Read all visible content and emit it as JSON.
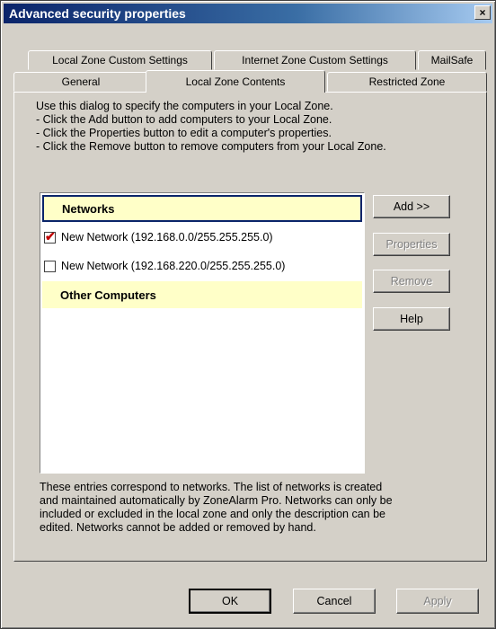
{
  "window": {
    "title": "Advanced security properties",
    "close_glyph": "×"
  },
  "tabs_row1": [
    {
      "label": "Local Zone Custom Settings"
    },
    {
      "label": "Internet Zone Custom Settings"
    },
    {
      "label": "MailSafe"
    }
  ],
  "tabs_row2": [
    {
      "label": "General"
    },
    {
      "label": "Local Zone Contents",
      "active": true
    },
    {
      "label": "Restricted Zone"
    }
  ],
  "description": [
    "Use this dialog to specify the computers in your Local Zone.",
    "- Click the Add button to add computers to your Local Zone.",
    "- Click the Properties button to edit a computer's properties.",
    "- Click the Remove button to remove computers from your Local Zone."
  ],
  "list": {
    "networks_header": "Networks",
    "networks": [
      {
        "label": "New Network (192.168.0.0/255.255.255.0)",
        "checked": true
      },
      {
        "label": "New Network (192.168.220.0/255.255.255.0)",
        "checked": false
      }
    ],
    "other_header": "Other Computers"
  },
  "side_buttons": {
    "add": "Add >>",
    "properties": "Properties",
    "remove": "Remove",
    "help": "Help"
  },
  "footer_text": [
    "These entries correspond to networks. The list of networks is created",
    "and maintained automatically by ZoneAlarm Pro. Networks can only be",
    "included or excluded in the local zone and only the description can be",
    "edited. Networks cannot be added or removed by hand."
  ],
  "dialog_buttons": {
    "ok": "OK",
    "cancel": "Cancel",
    "apply": "Apply"
  },
  "colors": {
    "title_gradient_start": "#0a246a",
    "list_header_bg": "#ffffc8",
    "check_mark": "#c00000"
  }
}
